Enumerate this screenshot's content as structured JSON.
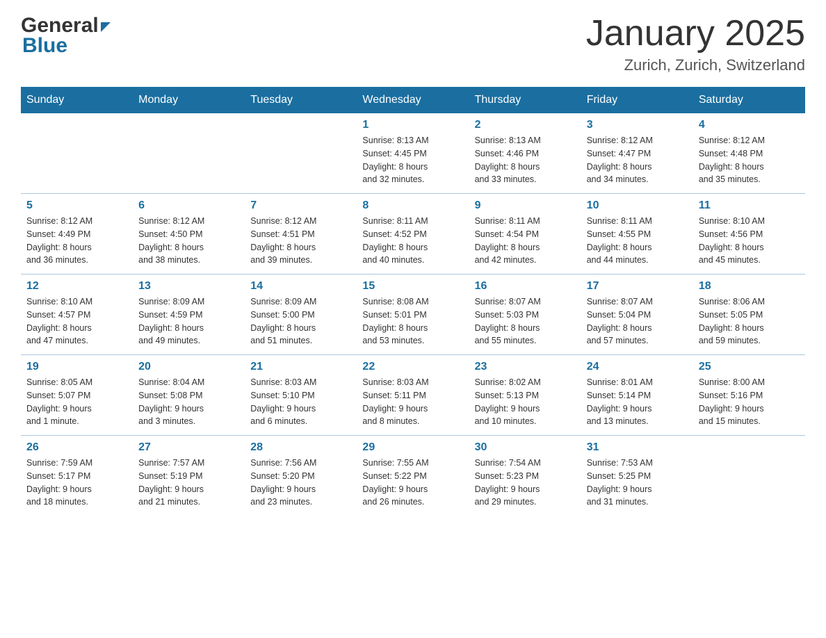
{
  "header": {
    "logo_general": "General",
    "logo_blue": "Blue",
    "month_title": "January 2025",
    "location": "Zurich, Zurich, Switzerland"
  },
  "weekdays": [
    "Sunday",
    "Monday",
    "Tuesday",
    "Wednesday",
    "Thursday",
    "Friday",
    "Saturday"
  ],
  "weeks": [
    {
      "days": [
        {
          "num": "",
          "info": ""
        },
        {
          "num": "",
          "info": ""
        },
        {
          "num": "",
          "info": ""
        },
        {
          "num": "1",
          "info": "Sunrise: 8:13 AM\nSunset: 4:45 PM\nDaylight: 8 hours\nand 32 minutes."
        },
        {
          "num": "2",
          "info": "Sunrise: 8:13 AM\nSunset: 4:46 PM\nDaylight: 8 hours\nand 33 minutes."
        },
        {
          "num": "3",
          "info": "Sunrise: 8:12 AM\nSunset: 4:47 PM\nDaylight: 8 hours\nand 34 minutes."
        },
        {
          "num": "4",
          "info": "Sunrise: 8:12 AM\nSunset: 4:48 PM\nDaylight: 8 hours\nand 35 minutes."
        }
      ]
    },
    {
      "days": [
        {
          "num": "5",
          "info": "Sunrise: 8:12 AM\nSunset: 4:49 PM\nDaylight: 8 hours\nand 36 minutes."
        },
        {
          "num": "6",
          "info": "Sunrise: 8:12 AM\nSunset: 4:50 PM\nDaylight: 8 hours\nand 38 minutes."
        },
        {
          "num": "7",
          "info": "Sunrise: 8:12 AM\nSunset: 4:51 PM\nDaylight: 8 hours\nand 39 minutes."
        },
        {
          "num": "8",
          "info": "Sunrise: 8:11 AM\nSunset: 4:52 PM\nDaylight: 8 hours\nand 40 minutes."
        },
        {
          "num": "9",
          "info": "Sunrise: 8:11 AM\nSunset: 4:54 PM\nDaylight: 8 hours\nand 42 minutes."
        },
        {
          "num": "10",
          "info": "Sunrise: 8:11 AM\nSunset: 4:55 PM\nDaylight: 8 hours\nand 44 minutes."
        },
        {
          "num": "11",
          "info": "Sunrise: 8:10 AM\nSunset: 4:56 PM\nDaylight: 8 hours\nand 45 minutes."
        }
      ]
    },
    {
      "days": [
        {
          "num": "12",
          "info": "Sunrise: 8:10 AM\nSunset: 4:57 PM\nDaylight: 8 hours\nand 47 minutes."
        },
        {
          "num": "13",
          "info": "Sunrise: 8:09 AM\nSunset: 4:59 PM\nDaylight: 8 hours\nand 49 minutes."
        },
        {
          "num": "14",
          "info": "Sunrise: 8:09 AM\nSunset: 5:00 PM\nDaylight: 8 hours\nand 51 minutes."
        },
        {
          "num": "15",
          "info": "Sunrise: 8:08 AM\nSunset: 5:01 PM\nDaylight: 8 hours\nand 53 minutes."
        },
        {
          "num": "16",
          "info": "Sunrise: 8:07 AM\nSunset: 5:03 PM\nDaylight: 8 hours\nand 55 minutes."
        },
        {
          "num": "17",
          "info": "Sunrise: 8:07 AM\nSunset: 5:04 PM\nDaylight: 8 hours\nand 57 minutes."
        },
        {
          "num": "18",
          "info": "Sunrise: 8:06 AM\nSunset: 5:05 PM\nDaylight: 8 hours\nand 59 minutes."
        }
      ]
    },
    {
      "days": [
        {
          "num": "19",
          "info": "Sunrise: 8:05 AM\nSunset: 5:07 PM\nDaylight: 9 hours\nand 1 minute."
        },
        {
          "num": "20",
          "info": "Sunrise: 8:04 AM\nSunset: 5:08 PM\nDaylight: 9 hours\nand 3 minutes."
        },
        {
          "num": "21",
          "info": "Sunrise: 8:03 AM\nSunset: 5:10 PM\nDaylight: 9 hours\nand 6 minutes."
        },
        {
          "num": "22",
          "info": "Sunrise: 8:03 AM\nSunset: 5:11 PM\nDaylight: 9 hours\nand 8 minutes."
        },
        {
          "num": "23",
          "info": "Sunrise: 8:02 AM\nSunset: 5:13 PM\nDaylight: 9 hours\nand 10 minutes."
        },
        {
          "num": "24",
          "info": "Sunrise: 8:01 AM\nSunset: 5:14 PM\nDaylight: 9 hours\nand 13 minutes."
        },
        {
          "num": "25",
          "info": "Sunrise: 8:00 AM\nSunset: 5:16 PM\nDaylight: 9 hours\nand 15 minutes."
        }
      ]
    },
    {
      "days": [
        {
          "num": "26",
          "info": "Sunrise: 7:59 AM\nSunset: 5:17 PM\nDaylight: 9 hours\nand 18 minutes."
        },
        {
          "num": "27",
          "info": "Sunrise: 7:57 AM\nSunset: 5:19 PM\nDaylight: 9 hours\nand 21 minutes."
        },
        {
          "num": "28",
          "info": "Sunrise: 7:56 AM\nSunset: 5:20 PM\nDaylight: 9 hours\nand 23 minutes."
        },
        {
          "num": "29",
          "info": "Sunrise: 7:55 AM\nSunset: 5:22 PM\nDaylight: 9 hours\nand 26 minutes."
        },
        {
          "num": "30",
          "info": "Sunrise: 7:54 AM\nSunset: 5:23 PM\nDaylight: 9 hours\nand 29 minutes."
        },
        {
          "num": "31",
          "info": "Sunrise: 7:53 AM\nSunset: 5:25 PM\nDaylight: 9 hours\nand 31 minutes."
        },
        {
          "num": "",
          "info": ""
        }
      ]
    }
  ]
}
